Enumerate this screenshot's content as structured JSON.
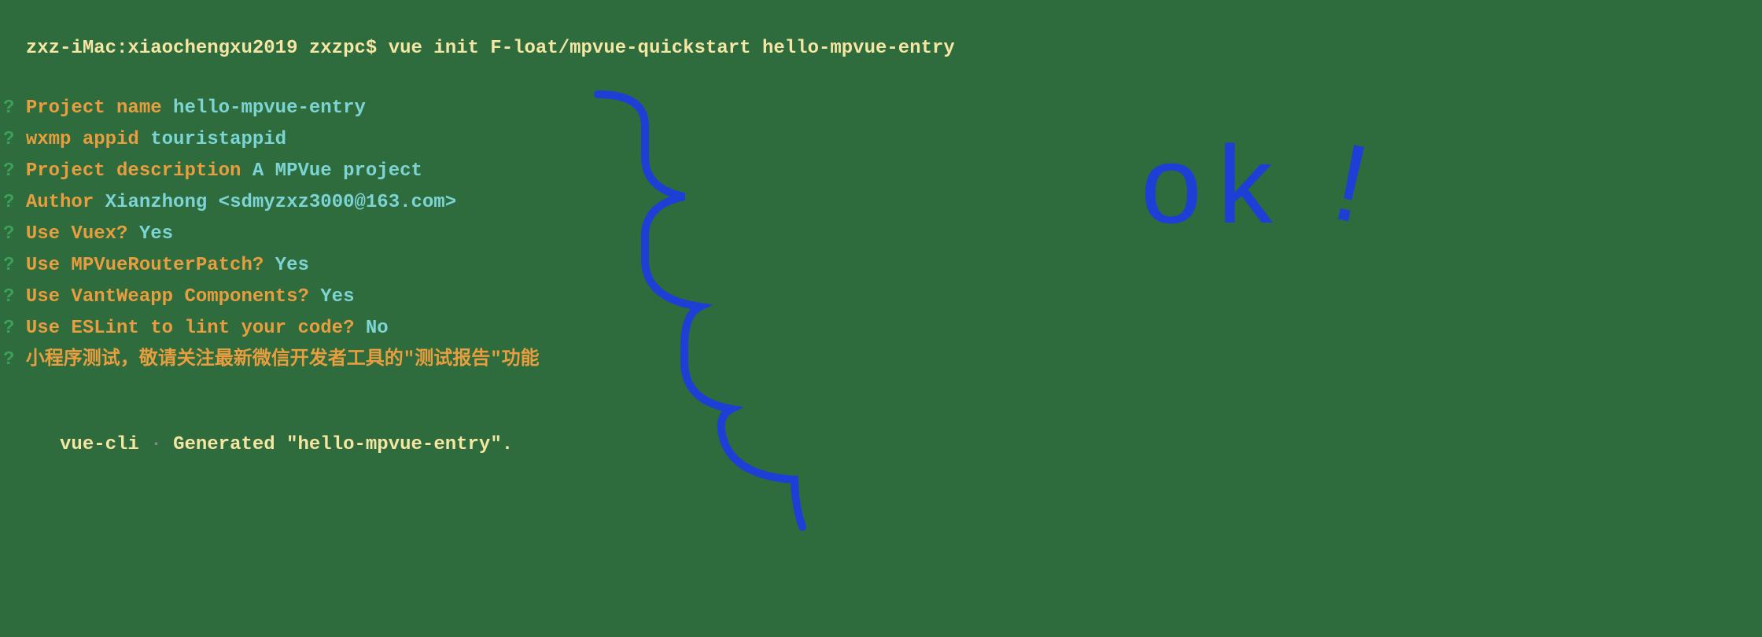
{
  "command": {
    "prompt": "zxz-iMac:xiaochengxu2019 zxzpc$ ",
    "text": "vue init F-loat/mpvue-quickstart hello-mpvue-entry"
  },
  "questions": [
    {
      "mark": "?",
      "label": "Project name",
      "value": "hello-mpvue-entry"
    },
    {
      "mark": "?",
      "label": "wxmp appid",
      "value": "touristappid"
    },
    {
      "mark": "?",
      "label": "Project description",
      "value": "A MPVue project"
    },
    {
      "mark": "?",
      "label": "Author",
      "value": "Xianzhong <sdmyzxz3000@163.com>"
    },
    {
      "mark": "?",
      "label": "Use Vuex?",
      "value": "Yes"
    },
    {
      "mark": "?",
      "label": "Use MPVueRouterPatch?",
      "value": "Yes"
    },
    {
      "mark": "?",
      "label": "Use VantWeapp Components?",
      "value": "Yes"
    },
    {
      "mark": "?",
      "label": "Use ESLint to lint your code?",
      "value": "No"
    },
    {
      "mark": "?",
      "label": "小程序测试，敬请关注最新微信开发者工具的\"测试报告\"功能",
      "value": ""
    }
  ],
  "footer": {
    "prefix": "   vue-cli",
    "bullet": " · ",
    "message": "Generated \"hello-mpvue-entry\"."
  },
  "annotation": {
    "text": "ok",
    "exclaim": "!"
  }
}
